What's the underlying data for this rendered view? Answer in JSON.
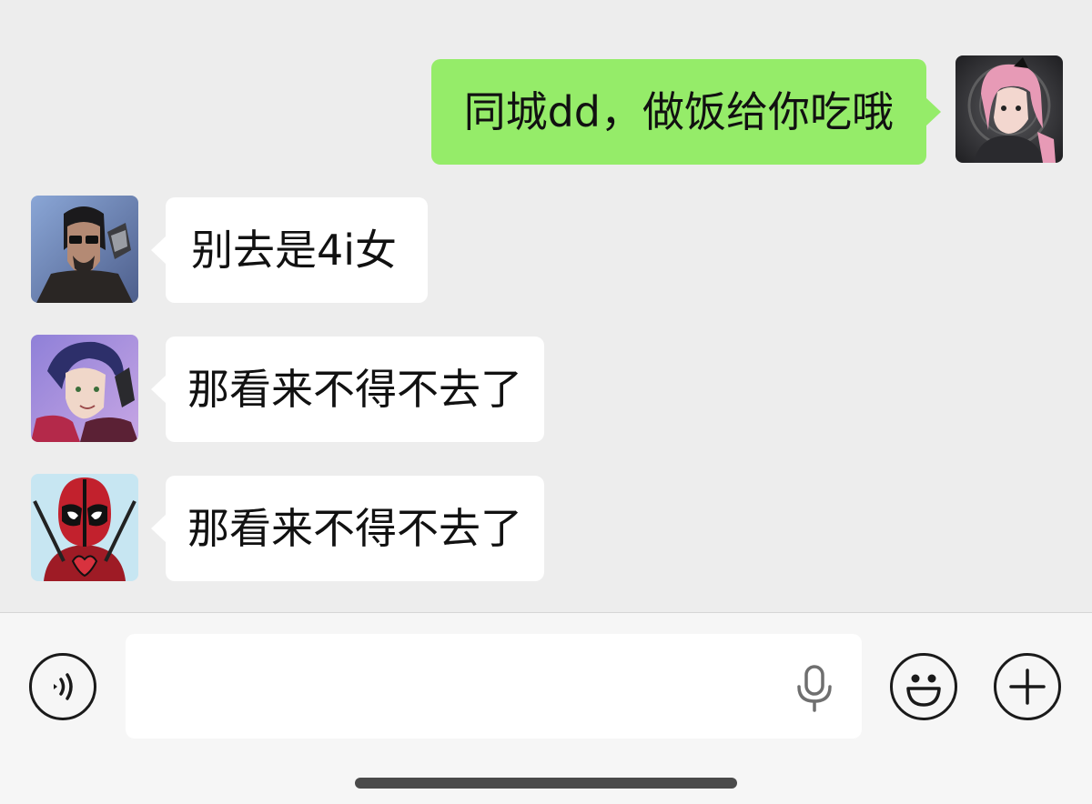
{
  "messages": [
    {
      "sender": "me",
      "text": "同城dd，做饭给你吃哦"
    },
    {
      "sender": "other",
      "text": "别去是4i女"
    },
    {
      "sender": "other",
      "text": "那看来不得不去了"
    },
    {
      "sender": "other",
      "text": "那看来不得不去了"
    }
  ],
  "input_bar": {
    "voice_icon": "voice-mode-icon",
    "mic_icon": "microphone-icon",
    "emoji_icon": "emoji-icon",
    "plus_icon": "plus-icon",
    "placeholder": ""
  },
  "colors": {
    "background": "#ededed",
    "my_bubble": "#95ec69",
    "their_bubble": "#ffffff",
    "input_bar": "#f6f6f6"
  }
}
